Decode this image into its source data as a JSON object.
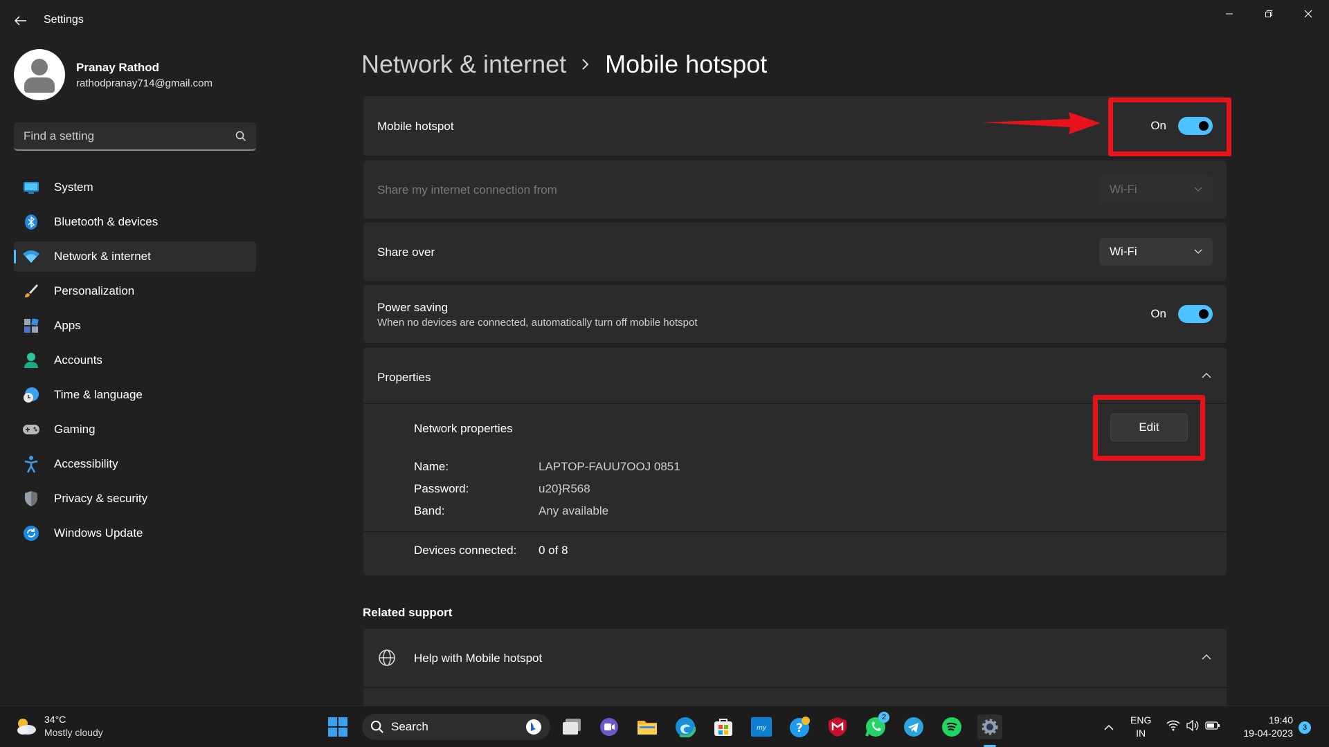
{
  "window": {
    "title": "Settings"
  },
  "profile": {
    "name": "Pranay Rathod",
    "email": "rathodpranay714@gmail.com"
  },
  "search": {
    "placeholder": "Find a setting"
  },
  "sidebar": {
    "items": [
      {
        "label": "System",
        "icon": "monitor-icon"
      },
      {
        "label": "Bluetooth & devices",
        "icon": "bluetooth-icon"
      },
      {
        "label": "Network & internet",
        "icon": "wifi-icon",
        "active": true
      },
      {
        "label": "Personalization",
        "icon": "brush-icon"
      },
      {
        "label": "Apps",
        "icon": "apps-icon"
      },
      {
        "label": "Accounts",
        "icon": "person-icon"
      },
      {
        "label": "Time & language",
        "icon": "clock-globe-icon"
      },
      {
        "label": "Gaming",
        "icon": "gamepad-icon"
      },
      {
        "label": "Accessibility",
        "icon": "accessibility-icon"
      },
      {
        "label": "Privacy & security",
        "icon": "shield-icon"
      },
      {
        "label": "Windows Update",
        "icon": "refresh-icon"
      }
    ]
  },
  "breadcrumb": {
    "parent": "Network & internet",
    "current": "Mobile hotspot"
  },
  "hotspot": {
    "label": "Mobile hotspot",
    "state": "On",
    "enabled": true
  },
  "share_from": {
    "label": "Share my internet connection from",
    "value": "Wi-Fi"
  },
  "share_over": {
    "label": "Share over",
    "value": "Wi-Fi"
  },
  "power_saving": {
    "label": "Power saving",
    "description": "When no devices are connected, automatically turn off mobile hotspot",
    "state": "On"
  },
  "properties": {
    "label": "Properties",
    "network_label": "Network properties",
    "edit_label": "Edit",
    "name_key": "Name:",
    "name_val": "LAPTOP-FAUU7OOJ 0851",
    "password_key": "Password:",
    "password_val": "u20}R568",
    "band_key": "Band:",
    "band_val": "Any available",
    "devices_key": "Devices connected:",
    "devices_val": "0 of 8"
  },
  "related": {
    "title": "Related support",
    "help_label": "Help with Mobile hotspot"
  },
  "taskbar": {
    "weather_temp": "34°C",
    "weather_desc": "Mostly cloudy",
    "search_label": "Search",
    "lang_1": "ENG",
    "lang_2": "IN",
    "time": "19:40",
    "date": "19-04-2023",
    "whatsapp_badge": "2",
    "notification_count": "3"
  },
  "colors": {
    "accent": "#4cc2ff",
    "highlight": "#e8121a",
    "background": "#202020",
    "card": "#2b2b2b"
  }
}
